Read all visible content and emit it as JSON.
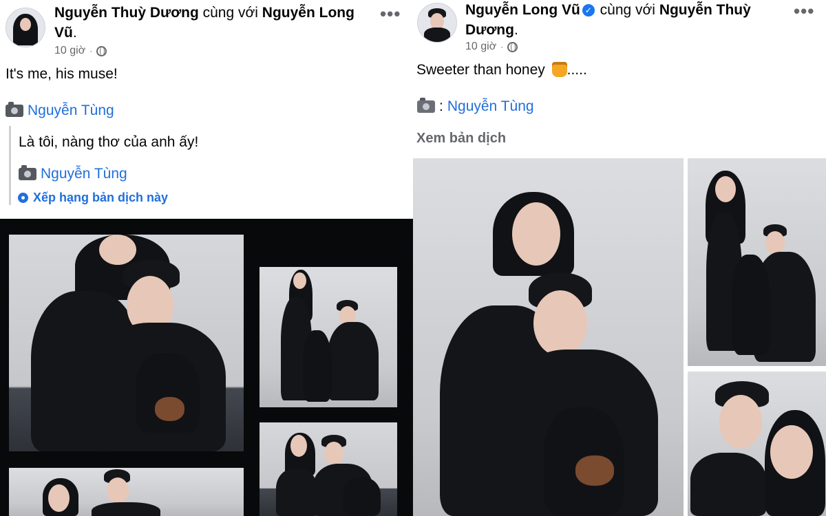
{
  "left_post": {
    "author": "Nguyễn Thuỳ Dương",
    "with_text": " cùng với ",
    "tagged": "Nguyễn Long Vũ",
    "tagged_end": ".",
    "time": "10 giờ",
    "dot": "·",
    "more": "•••",
    "body": "It's me, his muse!",
    "credit_name": "Nguyễn Tùng",
    "translation": {
      "text": "Là tôi, nàng thơ của anh ấy!",
      "credit_name": "Nguyễn Tùng",
      "rate_label": "Xếp hạng bản dịch này"
    }
  },
  "right_post": {
    "author": "Nguyễn Long Vũ",
    "verified": "✓",
    "with_text": " cùng với ",
    "tagged": "Nguyễn Thuỳ Dương",
    "tagged_end": ".",
    "time": "10 giờ",
    "dot": "·",
    "more": "•••",
    "body": "Sweeter than honey",
    "body_end": ".....",
    "credit_prefix": ":",
    "credit_name": "Nguyễn Tùng",
    "see_translation": "Xem bản dịch"
  },
  "colors": {
    "link": "#216fdb",
    "meta": "#65676b",
    "text": "#050505",
    "verified": "#1877f2"
  }
}
